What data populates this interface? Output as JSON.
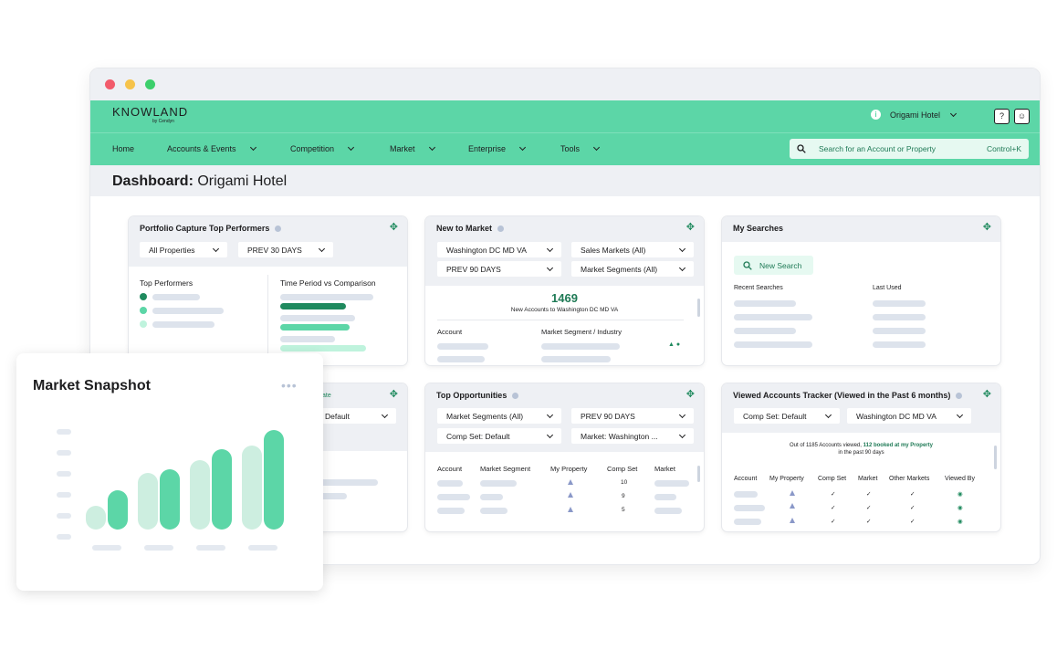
{
  "window": {
    "dots": [
      "#f25b6b",
      "#f6c34a",
      "#3ccf6b"
    ]
  },
  "header": {
    "logo": "KNOWLAND",
    "logo_sub": "by Cendyn",
    "hotel_selector": "Origami Hotel"
  },
  "nav": {
    "items": [
      {
        "label": "Home",
        "has_menu": false
      },
      {
        "label": "Accounts & Events",
        "has_menu": true
      },
      {
        "label": "Competition",
        "has_menu": true
      },
      {
        "label": "Market",
        "has_menu": true
      },
      {
        "label": "Enterprise",
        "has_menu": true
      },
      {
        "label": "Tools",
        "has_menu": true
      }
    ],
    "search": {
      "placeholder": "Search for an Account or Property",
      "shortcut": "Control+K"
    }
  },
  "page": {
    "title_prefix": "Dashboard:",
    "title_name": "Origami Hotel"
  },
  "portfolio": {
    "title": "Portfolio Capture Top Performers",
    "filter1": "All Properties",
    "filter2": "PREV 30 DAYS",
    "top_performers": "Top Performers",
    "time_period": "Time Period vs Comparison",
    "dot_colors": [
      "#1f8a5e",
      "#5cd6a7",
      "#bff3dd"
    ]
  },
  "new_to_market": {
    "title": "New to Market",
    "filter1": "Washington DC MD VA",
    "filter2": "Sales Markets (All)",
    "filter3": "PREV 90 DAYS",
    "filter4": "Market Segments (All)",
    "count": "1469",
    "count_label": "New Accounts to Washington DC MD VA",
    "col1": "Account",
    "col2": "Market Segment / Industry"
  },
  "my_searches": {
    "title": "My Searches",
    "new_search": "New Search",
    "recent": "Recent Searches",
    "last_used": "Last Used"
  },
  "hidden_card": {
    "partial_text": "ate",
    "filter": "Default"
  },
  "top_opps": {
    "title": "Top Opportunities",
    "filter1": "Market Segments (All)",
    "filter2": "PREV 90 DAYS",
    "filter3": "Comp Set: Default",
    "filter4": "Market: Washington ...",
    "cols": [
      "Account",
      "Market Segment",
      "My Property",
      "Comp Set",
      "Market"
    ],
    "comp_values": [
      "10",
      "9",
      "5"
    ]
  },
  "viewed": {
    "title": "Viewed Accounts Tracker (Viewed in the Past 6 months)",
    "filter1": "Comp Set: Default",
    "filter2": "Washington DC MD VA",
    "summary_a": "Out of 1185 Accounts viewed,",
    "summary_b": "112 booked at my Property",
    "summary_c": "in the past 90 days",
    "cols": [
      "Account",
      "My Property",
      "Comp Set",
      "Market",
      "Other Markets",
      "Viewed By"
    ]
  },
  "snapshot": {
    "title": "Market Snapshot",
    "chart_data": {
      "type": "bar",
      "categories": [
        "",
        "",
        "",
        ""
      ],
      "series": [
        {
          "name": "",
          "values": [
            26,
            62,
            76,
            92
          ]
        },
        {
          "name": "",
          "values": [
            43,
            66,
            88,
            109
          ]
        }
      ],
      "ylim": [
        0,
        115
      ],
      "colors": [
        "#cdeee0",
        "#5cd6a7"
      ]
    }
  }
}
